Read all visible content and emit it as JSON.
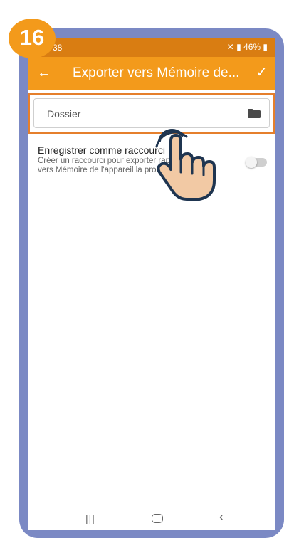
{
  "step_number": "16",
  "status_bar": {
    "time": "38",
    "icons_text": "46%"
  },
  "app_bar": {
    "title": "Exporter vers Mémoire de...",
    "back_icon": "arrow-left-icon",
    "confirm_icon": "check-icon"
  },
  "folder_field": {
    "placeholder": "Dossier",
    "icon": "folder-icon"
  },
  "shortcut_setting": {
    "title": "Enregistrer comme raccourci",
    "description_line1": "Créer un raccourci pour exporter rapidement",
    "description_line2": "vers Mémoire de l'appareil la prochaine fois.",
    "enabled": false
  },
  "nav_bar": {
    "recent_icon": "recent-apps-icon",
    "home_icon": "home-icon",
    "back_icon": "back-icon"
  },
  "colors": {
    "accent": "#f39a1b",
    "status_bar": "#d97d12",
    "highlight": "#e57f2c",
    "frame": "#7b89c4"
  }
}
